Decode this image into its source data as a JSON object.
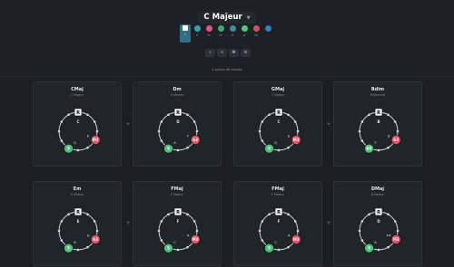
{
  "header": {
    "title": "C Majeur",
    "degrees": [
      {
        "label": "I",
        "color": "#ffffff",
        "selected": true
      },
      {
        "label": "ii",
        "color": "#3aa0b0"
      },
      {
        "label": "iii",
        "color": "#e0557a"
      },
      {
        "label": "IV",
        "color": "#43a96e"
      },
      {
        "label": "V",
        "color": "#3a8fa8"
      },
      {
        "label": "vi",
        "color": "#5bc48a"
      },
      {
        "label": "vii",
        "color": "#cf4f66"
      },
      {
        "label": "",
        "color": "#3a7fb8"
      }
    ],
    "tools": [
      "search-icon",
      "link-icon",
      "settings-icon",
      "help-icon"
    ],
    "pairs_label": "4 paires de triades"
  },
  "cards": [
    {
      "chord": "CMaj",
      "scale": "C Majeur",
      "root": "C",
      "mid": "E",
      "top_badge": "R",
      "left_badge": "5",
      "right_badge": "M3",
      "left_note": "G",
      "right_note": "E"
    },
    {
      "chord": "Dm",
      "scale": "D Mineur",
      "root": "D",
      "mid": "F",
      "top_badge": "R",
      "left_badge": "5",
      "right_badge": "b3",
      "left_note": "A",
      "right_note": "F"
    },
    {
      "chord": "GMaj",
      "scale": "C Majeur",
      "root": "C",
      "mid": "E",
      "top_badge": "R",
      "left_badge": "5",
      "right_badge": "M3",
      "left_note": "G",
      "right_note": "E"
    },
    {
      "chord": "Bdim",
      "scale": "B Diminué",
      "root": "B",
      "mid": "D",
      "top_badge": "R",
      "left_badge": "b5",
      "right_badge": "b3",
      "left_note": "F",
      "right_note": "D"
    },
    {
      "chord": "Em",
      "scale": "E Mineur",
      "root": "E",
      "mid": "B",
      "top_badge": "R",
      "left_badge": "5",
      "right_badge": "b3",
      "left_note": "B",
      "right_note": "G"
    },
    {
      "chord": "FMaj",
      "scale": "F Majeur",
      "root": "F",
      "mid": "A",
      "top_badge": "R",
      "left_badge": "5",
      "right_badge": "M3",
      "left_note": "C",
      "right_note": "A"
    },
    {
      "chord": "FMaj",
      "scale": "F Majeur",
      "root": "F",
      "mid": "A",
      "top_badge": "R",
      "left_badge": "5",
      "right_badge": "M3",
      "left_note": "C",
      "right_note": "A"
    },
    {
      "chord": "DMaj",
      "scale": "D Majeur",
      "root": "D",
      "mid": "F#",
      "top_badge": "R",
      "left_badge": "5",
      "right_badge": "M3",
      "left_note": "A",
      "right_note": "F#"
    }
  ],
  "colors": {
    "root_badge": "#f2f2f2",
    "third_badge": "#e25569",
    "fifth_badge": "#4fbf7a",
    "ring": "#d7dde2"
  }
}
